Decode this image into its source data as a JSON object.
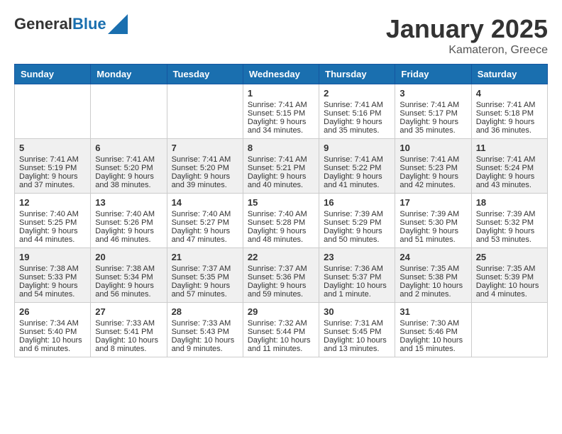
{
  "logo": {
    "general": "General",
    "blue": "Blue"
  },
  "header": {
    "month": "January 2025",
    "location": "Kamateron, Greece"
  },
  "weekdays": [
    "Sunday",
    "Monday",
    "Tuesday",
    "Wednesday",
    "Thursday",
    "Friday",
    "Saturday"
  ],
  "weeks": [
    [
      {
        "day": "",
        "info": ""
      },
      {
        "day": "",
        "info": ""
      },
      {
        "day": "",
        "info": ""
      },
      {
        "day": "1",
        "info": "Sunrise: 7:41 AM\nSunset: 5:15 PM\nDaylight: 9 hours\nand 34 minutes."
      },
      {
        "day": "2",
        "info": "Sunrise: 7:41 AM\nSunset: 5:16 PM\nDaylight: 9 hours\nand 35 minutes."
      },
      {
        "day": "3",
        "info": "Sunrise: 7:41 AM\nSunset: 5:17 PM\nDaylight: 9 hours\nand 35 minutes."
      },
      {
        "day": "4",
        "info": "Sunrise: 7:41 AM\nSunset: 5:18 PM\nDaylight: 9 hours\nand 36 minutes."
      }
    ],
    [
      {
        "day": "5",
        "info": "Sunrise: 7:41 AM\nSunset: 5:19 PM\nDaylight: 9 hours\nand 37 minutes."
      },
      {
        "day": "6",
        "info": "Sunrise: 7:41 AM\nSunset: 5:20 PM\nDaylight: 9 hours\nand 38 minutes."
      },
      {
        "day": "7",
        "info": "Sunrise: 7:41 AM\nSunset: 5:20 PM\nDaylight: 9 hours\nand 39 minutes."
      },
      {
        "day": "8",
        "info": "Sunrise: 7:41 AM\nSunset: 5:21 PM\nDaylight: 9 hours\nand 40 minutes."
      },
      {
        "day": "9",
        "info": "Sunrise: 7:41 AM\nSunset: 5:22 PM\nDaylight: 9 hours\nand 41 minutes."
      },
      {
        "day": "10",
        "info": "Sunrise: 7:41 AM\nSunset: 5:23 PM\nDaylight: 9 hours\nand 42 minutes."
      },
      {
        "day": "11",
        "info": "Sunrise: 7:41 AM\nSunset: 5:24 PM\nDaylight: 9 hours\nand 43 minutes."
      }
    ],
    [
      {
        "day": "12",
        "info": "Sunrise: 7:40 AM\nSunset: 5:25 PM\nDaylight: 9 hours\nand 44 minutes."
      },
      {
        "day": "13",
        "info": "Sunrise: 7:40 AM\nSunset: 5:26 PM\nDaylight: 9 hours\nand 46 minutes."
      },
      {
        "day": "14",
        "info": "Sunrise: 7:40 AM\nSunset: 5:27 PM\nDaylight: 9 hours\nand 47 minutes."
      },
      {
        "day": "15",
        "info": "Sunrise: 7:40 AM\nSunset: 5:28 PM\nDaylight: 9 hours\nand 48 minutes."
      },
      {
        "day": "16",
        "info": "Sunrise: 7:39 AM\nSunset: 5:29 PM\nDaylight: 9 hours\nand 50 minutes."
      },
      {
        "day": "17",
        "info": "Sunrise: 7:39 AM\nSunset: 5:30 PM\nDaylight: 9 hours\nand 51 minutes."
      },
      {
        "day": "18",
        "info": "Sunrise: 7:39 AM\nSunset: 5:32 PM\nDaylight: 9 hours\nand 53 minutes."
      }
    ],
    [
      {
        "day": "19",
        "info": "Sunrise: 7:38 AM\nSunset: 5:33 PM\nDaylight: 9 hours\nand 54 minutes."
      },
      {
        "day": "20",
        "info": "Sunrise: 7:38 AM\nSunset: 5:34 PM\nDaylight: 9 hours\nand 56 minutes."
      },
      {
        "day": "21",
        "info": "Sunrise: 7:37 AM\nSunset: 5:35 PM\nDaylight: 9 hours\nand 57 minutes."
      },
      {
        "day": "22",
        "info": "Sunrise: 7:37 AM\nSunset: 5:36 PM\nDaylight: 9 hours\nand 59 minutes."
      },
      {
        "day": "23",
        "info": "Sunrise: 7:36 AM\nSunset: 5:37 PM\nDaylight: 10 hours\nand 1 minute."
      },
      {
        "day": "24",
        "info": "Sunrise: 7:35 AM\nSunset: 5:38 PM\nDaylight: 10 hours\nand 2 minutes."
      },
      {
        "day": "25",
        "info": "Sunrise: 7:35 AM\nSunset: 5:39 PM\nDaylight: 10 hours\nand 4 minutes."
      }
    ],
    [
      {
        "day": "26",
        "info": "Sunrise: 7:34 AM\nSunset: 5:40 PM\nDaylight: 10 hours\nand 6 minutes."
      },
      {
        "day": "27",
        "info": "Sunrise: 7:33 AM\nSunset: 5:41 PM\nDaylight: 10 hours\nand 8 minutes."
      },
      {
        "day": "28",
        "info": "Sunrise: 7:33 AM\nSunset: 5:43 PM\nDaylight: 10 hours\nand 9 minutes."
      },
      {
        "day": "29",
        "info": "Sunrise: 7:32 AM\nSunset: 5:44 PM\nDaylight: 10 hours\nand 11 minutes."
      },
      {
        "day": "30",
        "info": "Sunrise: 7:31 AM\nSunset: 5:45 PM\nDaylight: 10 hours\nand 13 minutes."
      },
      {
        "day": "31",
        "info": "Sunrise: 7:30 AM\nSunset: 5:46 PM\nDaylight: 10 hours\nand 15 minutes."
      },
      {
        "day": "",
        "info": ""
      }
    ]
  ]
}
